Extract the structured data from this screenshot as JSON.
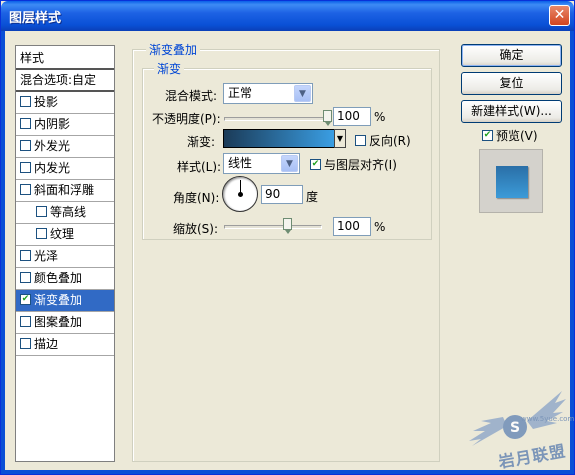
{
  "window": {
    "title": "图层样式",
    "close_glyph": "✕"
  },
  "style_list": {
    "header": "样式",
    "blend_options": "混合选项:自定",
    "items": [
      {
        "label": "投影",
        "checked": false,
        "sub": false,
        "selected": false
      },
      {
        "label": "内阴影",
        "checked": false,
        "sub": false,
        "selected": false
      },
      {
        "label": "外发光",
        "checked": false,
        "sub": false,
        "selected": false
      },
      {
        "label": "内发光",
        "checked": false,
        "sub": false,
        "selected": false
      },
      {
        "label": "斜面和浮雕",
        "checked": false,
        "sub": false,
        "selected": false
      },
      {
        "label": "等高线",
        "checked": false,
        "sub": true,
        "selected": false
      },
      {
        "label": "纹理",
        "checked": false,
        "sub": true,
        "selected": false
      },
      {
        "label": "光泽",
        "checked": false,
        "sub": false,
        "selected": false
      },
      {
        "label": "颜色叠加",
        "checked": false,
        "sub": false,
        "selected": false
      },
      {
        "label": "渐变叠加",
        "checked": true,
        "sub": false,
        "selected": true
      },
      {
        "label": "图案叠加",
        "checked": false,
        "sub": false,
        "selected": false
      },
      {
        "label": "描边",
        "checked": false,
        "sub": false,
        "selected": false
      }
    ]
  },
  "panel": {
    "outer_title": "渐变叠加",
    "inner_title": "渐变",
    "blend_mode": {
      "label": "混合模式:",
      "value": "正常",
      "arrow": "▼"
    },
    "opacity": {
      "label": "不透明度(P):",
      "value": "100",
      "unit": "%",
      "percent": 100
    },
    "gradient": {
      "label": "渐变:",
      "drop_glyph": "▼"
    },
    "reverse": {
      "label": "反向(R)",
      "checked": false
    },
    "style": {
      "label": "样式(L):",
      "value": "线性",
      "arrow": "▼"
    },
    "align_layer": {
      "label": "与图层对齐(I)",
      "checked": true
    },
    "angle": {
      "label": "角度(N):",
      "value": "90",
      "unit": "度"
    },
    "scale": {
      "label": "缩放(S):",
      "value": "100",
      "unit": "%",
      "percent": 100
    }
  },
  "buttons": {
    "ok": "确定",
    "reset": "复位",
    "new_style": "新建样式(W)...",
    "preview": {
      "label": "预览(V)",
      "checked": true
    }
  },
  "watermark": {
    "text": "岩月联盟",
    "url": "www.5yue.com"
  },
  "colors": {
    "accent_blue": "#316ac5",
    "gradient_start": "#1b3b58",
    "gradient_end": "#3a9ee3"
  }
}
